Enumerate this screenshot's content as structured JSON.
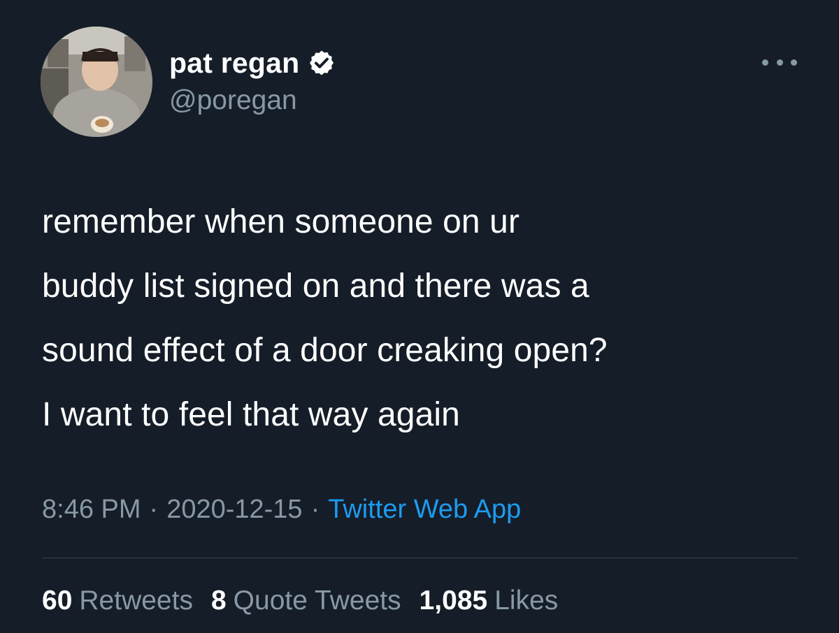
{
  "user": {
    "display_name": "pat regan",
    "handle": "@poregan",
    "verified": true,
    "verified_icon": "verified-badge-icon"
  },
  "tweet": {
    "lines": [
      "remember when someone on ur",
      "buddy list signed on and there was a",
      "sound effect of a door creaking open?",
      "I want to feel that way again"
    ]
  },
  "meta": {
    "time": "8:46 PM",
    "separator": "·",
    "date": "2020-12-15",
    "source": "Twitter Web App"
  },
  "stats": {
    "retweets": {
      "count": "60",
      "label": "Retweets"
    },
    "quote_tweets": {
      "count": "8",
      "label": "Quote Tweets"
    },
    "likes": {
      "count": "1,085",
      "label": "Likes"
    }
  },
  "colors": {
    "background": "#151d28",
    "text": "#ffffff",
    "secondary": "#8899a6",
    "accent": "#1d9bf0",
    "divider": "#38444d"
  }
}
